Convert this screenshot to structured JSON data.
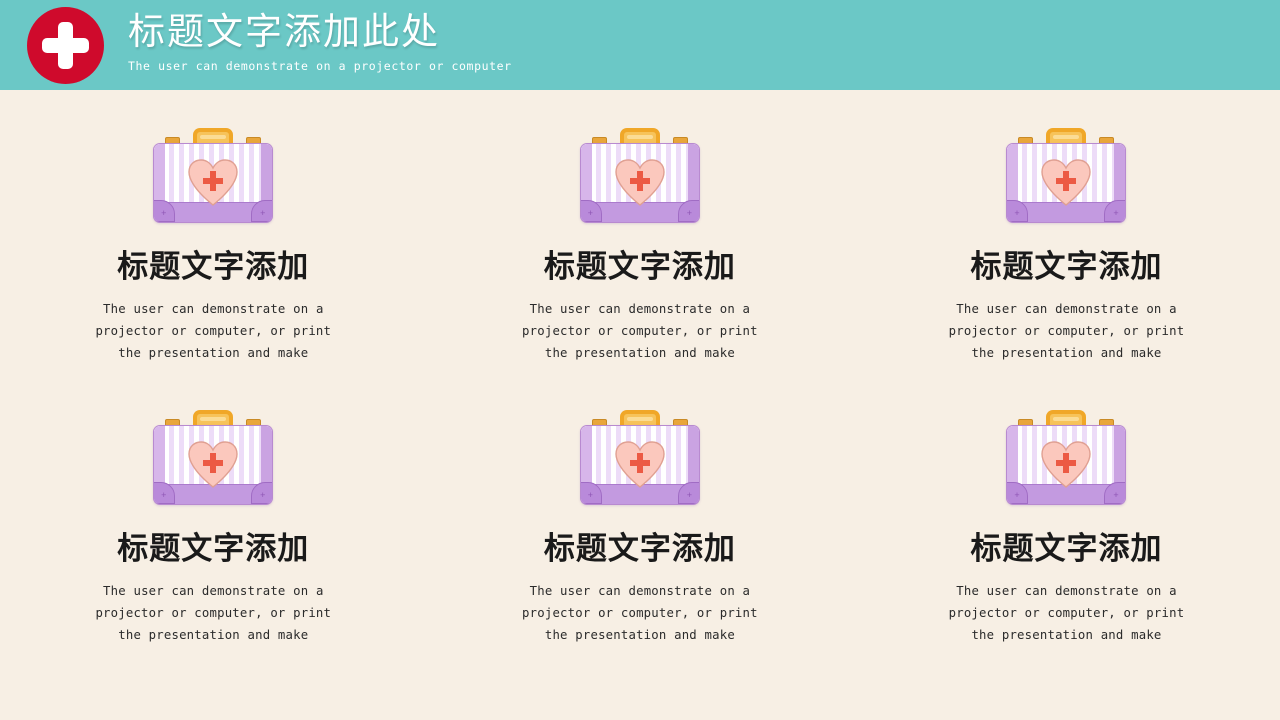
{
  "header": {
    "logo_icon": "red-cross-circle-icon",
    "title": "标题文字添加此处",
    "subtitle": "The user can demonstrate on a projector or computer",
    "background_color": "#6bc8c6",
    "logo_color": "#cf0a2c",
    "text_color": "#ffffff"
  },
  "page": {
    "background_color": "#f7efe4",
    "icon_name": "medical-suitcase-icon"
  },
  "cards": [
    {
      "icon": "medical-suitcase-icon",
      "title": "标题文字添加",
      "body": "The user can demonstrate on a projector or computer, or print the presentation and make"
    },
    {
      "icon": "medical-suitcase-icon",
      "title": "标题文字添加",
      "body": "The user can demonstrate on a projector or computer, or print the presentation and make"
    },
    {
      "icon": "medical-suitcase-icon",
      "title": "标题文字添加",
      "body": "The user can demonstrate on a projector or computer, or print the presentation and make"
    },
    {
      "icon": "medical-suitcase-icon",
      "title": "标题文字添加",
      "body": "The user can demonstrate on a projector or computer, or print the presentation and make"
    },
    {
      "icon": "medical-suitcase-icon",
      "title": "标题文字添加",
      "body": "The user can demonstrate on a projector or computer, or print the presentation and make"
    },
    {
      "icon": "medical-suitcase-icon",
      "title": "标题文字添加",
      "body": "The user can demonstrate on a projector or computer, or print the presentation and make"
    }
  ]
}
